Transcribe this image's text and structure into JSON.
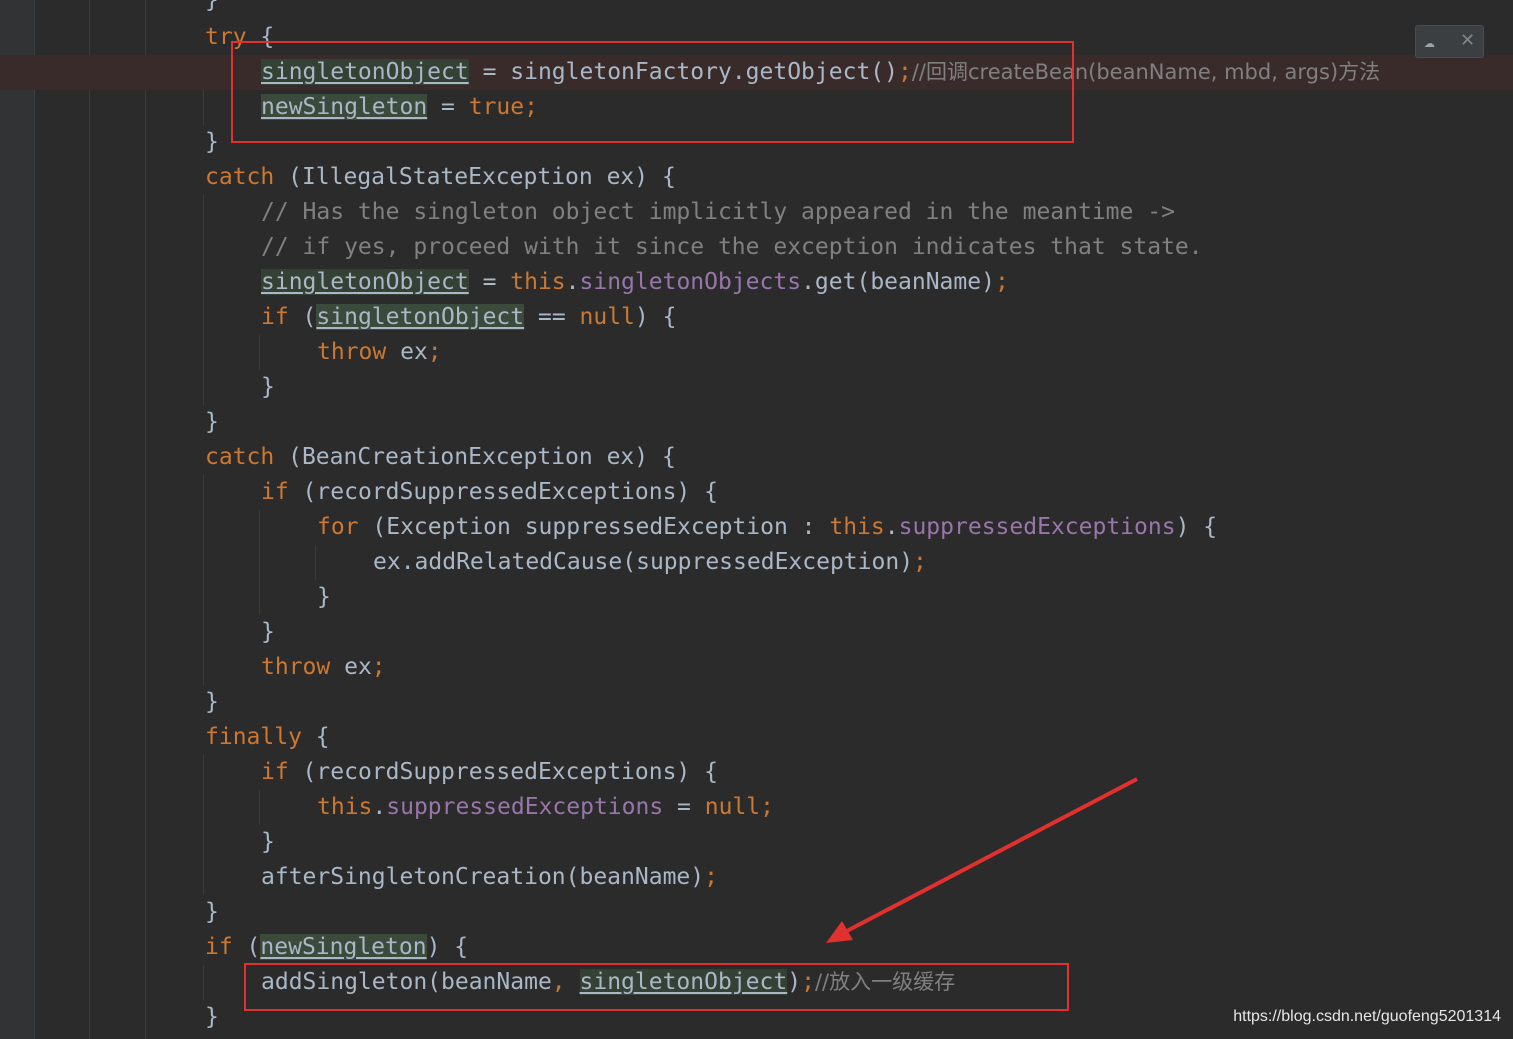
{
  "editor": {
    "lines": {
      "l0": "}",
      "try_kw": "try",
      "try_brace": " {",
      "l1_var": "singletonObject",
      "l1_rest": " = singletonFactory.getObject()",
      "l1_semi": ";",
      "l1_comment": "//回调createBean(beanName, mbd, args)方法",
      "l2_var": "newSingleton",
      "l2_eq": " = ",
      "l2_true": "true",
      "l2_semi": ";",
      "l3": "}",
      "catch1_kw": "catch",
      "catch1_rest": " (IllegalStateException ex) {",
      "c1": "// Has the singleton object implicitly appeared in the meantime ->",
      "c2": "// if yes, proceed with it since the exception indicates that state.",
      "l6_var": "singletonObject",
      "l6_eq": " = ",
      "l6_this": "this",
      "l6_dot": ".",
      "l6_field": "singletonObjects",
      "l6_rest": ".get(beanName)",
      "l6_semi": ";",
      "l7_if": "if",
      "l7_open": " (",
      "l7_var": "singletonObject",
      "l7_eq": " == ",
      "l7_null": "null",
      "l7_rest": ") {",
      "l8_throw": "throw",
      "l8_rest": " ex",
      "l8_semi": ";",
      "l9": "}",
      "l10": "}",
      "catch2_kw": "catch",
      "catch2_rest": " (BeanCreationException ex) {",
      "l12_if": "if",
      "l12_rest": " (recordSuppressedExceptions) {",
      "l13_for": "for",
      "l13_rest": " (Exception suppressedException : ",
      "l13_this": "this",
      "l13_dot": ".",
      "l13_field": "suppressedExceptions",
      "l13_end": ") {",
      "l14_rest": "ex.addRelatedCause(suppressedException)",
      "l14_semi": ";",
      "l15": "}",
      "l16": "}",
      "l17_throw": "throw",
      "l17_rest": " ex",
      "l17_semi": ";",
      "l18": "}",
      "finally_kw": "finally",
      "finally_rest": " {",
      "l20_if": "if",
      "l20_rest": " (recordSuppressedExceptions) {",
      "l21_this": "this",
      "l21_dot": ".",
      "l21_field": "suppressedExceptions",
      "l21_eq": " = ",
      "l21_null": "null",
      "l21_semi": ";",
      "l22": "}",
      "l23_rest": "afterSingletonCreation(beanName)",
      "l23_semi": ";",
      "l24": "}",
      "l25_if": "if",
      "l25_open": " (",
      "l25_var": "newSingleton",
      "l25_rest": ") {",
      "l26_rest": "addSingleton(beanName",
      "l26_comma": ", ",
      "l26_var": "singletonObject",
      "l26_close": ")",
      "l26_semi": ";",
      "l26_comment": "//放入一级缓存",
      "l27": "}"
    }
  },
  "watermark": "https://blog.csdn.net/guofeng5201314",
  "colors": {
    "background": "#2b2b2b",
    "keyword": "#cc7832",
    "field": "#9876aa",
    "comment": "#808080",
    "text": "#a9b7c6",
    "annotation": "#e0312f"
  }
}
